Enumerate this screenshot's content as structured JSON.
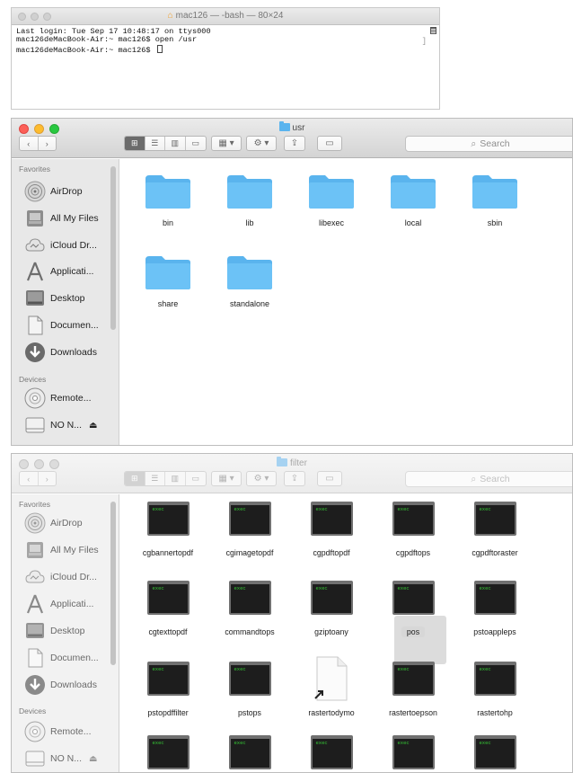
{
  "terminal": {
    "title": "mac126 — -bash — 80×24",
    "lines": [
      "Last login: Tue Sep 17 10:48:17 on ttys000",
      "mac126deMacBook-Air:~ mac126$ open /usr",
      "mac126deMacBook-Air:~ mac126$ "
    ]
  },
  "finder1": {
    "title": "usr",
    "search_placeholder": "Search",
    "favorites_header": "Favorites",
    "devices_header": "Devices",
    "sidebar": [
      "AirDrop",
      "All My Files",
      "iCloud Dr...",
      "Applicati...",
      "Desktop",
      "Documen...",
      "Downloads"
    ],
    "devices": [
      "Remote...",
      "NO N..."
    ],
    "folders": [
      "bin",
      "lib",
      "libexec",
      "local",
      "sbin",
      "share",
      "standalone"
    ]
  },
  "finder2": {
    "title": "filter",
    "search_placeholder": "Search",
    "favorites_header": "Favorites",
    "devices_header": "Devices",
    "sidebar": [
      "AirDrop",
      "All My Files",
      "iCloud Dr...",
      "Applicati...",
      "Desktop",
      "Documen...",
      "Downloads"
    ],
    "devices": [
      "Remote...",
      "NO N..."
    ],
    "exec_badge": "exec",
    "files": [
      "cgbannertopdf",
      "cgimagetopdf",
      "cgpdftopdf",
      "cgpdftops",
      "cgpdftoraster",
      "cgtexttopdf",
      "commandtops",
      "gziptoany",
      "pos",
      "pstoappleps",
      "pstopdffilter",
      "pstops",
      "rastertodymo",
      "rastertoepson",
      "rastertohp"
    ],
    "selected_file": "pos",
    "document_file": "rastertodymo"
  },
  "colors": {
    "folder_blue": "#5ab4ee",
    "exec_green": "#35c735",
    "close_red": "#fc5f57",
    "minimize_yellow": "#fdbc2e",
    "zoom_green": "#28c840"
  }
}
